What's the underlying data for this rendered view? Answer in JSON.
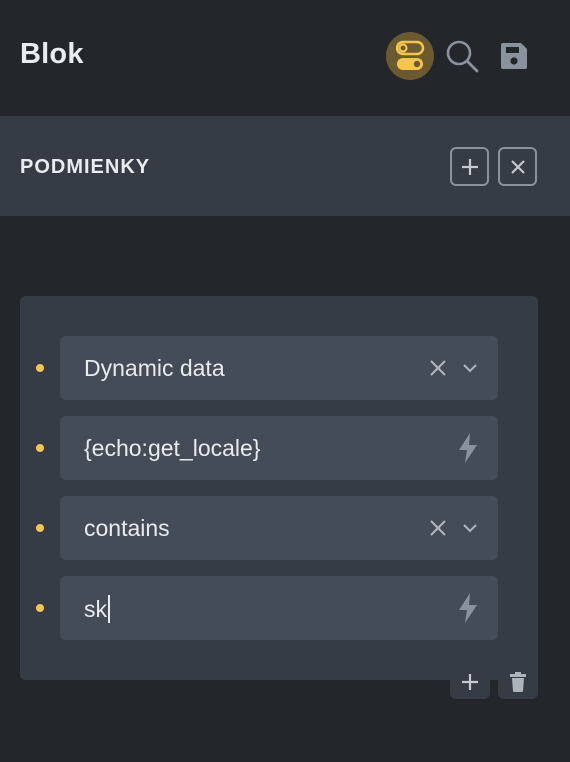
{
  "header": {
    "title": "Blok",
    "icons": [
      "toggle-icon",
      "search-icon",
      "save-icon"
    ]
  },
  "section": {
    "title": "PODMIENKY",
    "icons": [
      "plus-icon",
      "close-icon"
    ]
  },
  "conditions": [
    {
      "value": "Dynamic data",
      "control": "select"
    },
    {
      "value": "{echo:get_locale}",
      "control": "dynamic-input"
    },
    {
      "value": "contains",
      "control": "select"
    },
    {
      "value": "sk",
      "control": "dynamic-input"
    }
  ],
  "footer": {
    "icons": [
      "plus-icon",
      "trash-icon"
    ]
  },
  "colors": {
    "background": "#23262b",
    "panel": "#353c45",
    "field": "#444d57",
    "accent": "#f4c64e",
    "toggle_bg": "#6b5a2f"
  }
}
